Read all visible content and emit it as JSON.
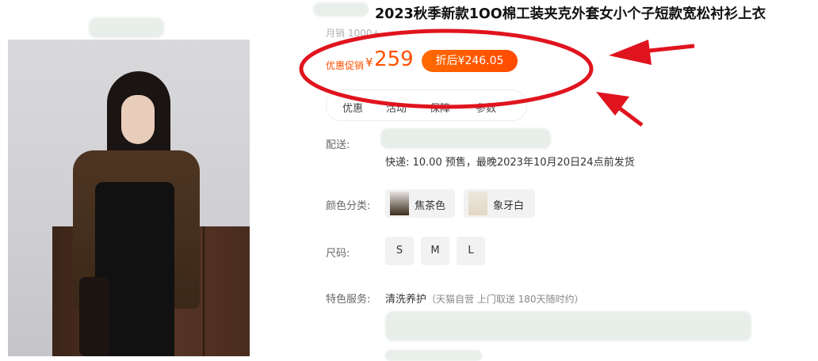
{
  "product": {
    "title": "2023秋季新款1OO棉工装夹克外套女小个子短款宽松衬衫上衣",
    "monthly_sales": "月销 1000+",
    "promo_label": "优惠促销",
    "currency": "¥",
    "price": "259",
    "discount_badge": "折后¥246.05"
  },
  "tabs": [
    {
      "label": "优惠"
    },
    {
      "label": "活动"
    },
    {
      "label": "保障"
    },
    {
      "label": "参数"
    }
  ],
  "delivery": {
    "label": "配送:",
    "text": "快递: 10.00  预售，最晚2023年10月20日24点前发货"
  },
  "color": {
    "label": "颜色分类:",
    "options": [
      {
        "label": "焦茶色"
      },
      {
        "label": "象牙白"
      }
    ]
  },
  "size": {
    "label": "尺码:",
    "options": [
      "S",
      "M",
      "L"
    ]
  },
  "service": {
    "label": "特色服务:",
    "name": "清洗养护",
    "detail": "（天猫自营 上门取送 180天随时约）"
  },
  "colors": {
    "accent": "#ff5000",
    "annotation": "#e0141e"
  },
  "annotations": [
    {
      "type": "ellipse",
      "target": "price"
    },
    {
      "type": "arrow",
      "target": "price",
      "direction": "left"
    },
    {
      "type": "arrow",
      "target": "price",
      "direction": "up-left"
    }
  ]
}
